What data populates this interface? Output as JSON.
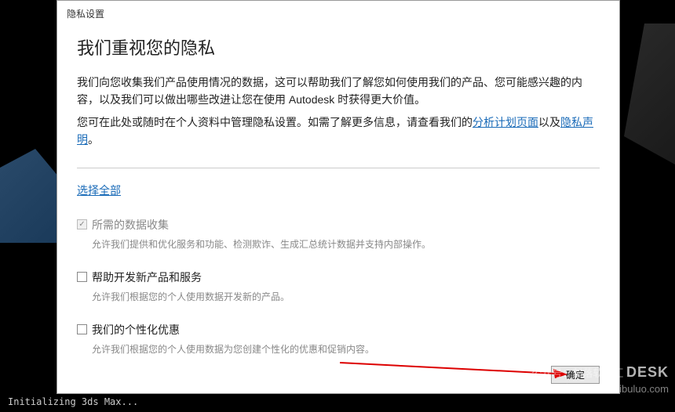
{
  "dialog": {
    "title": "隐私设置",
    "heading": "我们重视您的隐私",
    "intro1": "我们向您收集我们产品使用情况的数据，这可以帮助我们了解您如何使用我们的产品、您可能感兴趣的内容，以及我们可以做出哪些改进让您在使用 Autodesk 时获得更大价值。",
    "intro2_prefix": "您可在此处或随时在个人资料中管理隐私设置。如需了解更多信息，请查看我们的",
    "link_analysis": "分析计划页面",
    "intro2_mid": "以及",
    "link_privacy": "隐私声明",
    "intro2_suffix": "。",
    "select_all": "选择全部",
    "options": [
      {
        "label": "所需的数据收集",
        "desc": "允许我们提供和优化服务和功能、检测欺诈、生成汇总统计数据并支持内部操作。",
        "checked": true,
        "disabled": true
      },
      {
        "label": "帮助开发新产品和服务",
        "desc": "允许我们根据您的个人使用数据开发新的产品。",
        "checked": false,
        "disabled": false
      },
      {
        "label": "我们的个性化优惠",
        "desc": "允许我们根据您的个人使用数据为您创建个性化的优惠和促销内容。",
        "checked": false,
        "disabled": false
      }
    ],
    "ok_button": "确定"
  },
  "status_text": "Initializing 3ds Max...",
  "watermark": {
    "line1": "公众号：部落软件汇",
    "line2": "官网：www.libuluo.com",
    "brand": "DESK"
  }
}
